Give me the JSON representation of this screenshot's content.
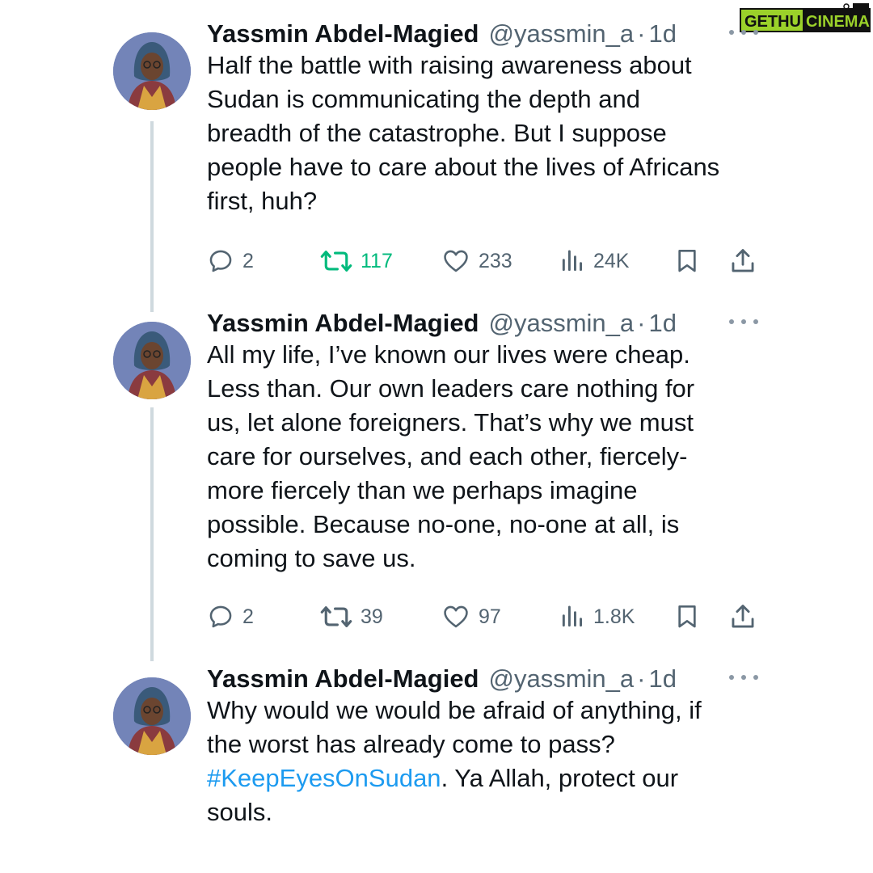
{
  "watermark": {
    "brand_left": "GETHU",
    "brand_right": "CINEMA"
  },
  "colors": {
    "name": "#0f1419",
    "muted": "#536471",
    "retweeted": "#00ba7c",
    "hashtag": "#1d9bf0",
    "thread_line": "#cfd9de"
  },
  "tweets": [
    {
      "author": {
        "name": "Yassmin Abdel-Magied",
        "handle": "@yassmin_a",
        "dot": "·",
        "time": "1d"
      },
      "lines": [
        "Half the battle with raising awareness about",
        "Sudan is communicating the depth and",
        "breadth of the catastrophe. But I suppose",
        "people have to care about the lives of Africans",
        "first, huh?"
      ],
      "stats": {
        "replies": "2",
        "retweets": "117",
        "likes": "233",
        "views": "24K"
      },
      "retweeted": true
    },
    {
      "author": {
        "name": "Yassmin Abdel-Magied",
        "handle": "@yassmin_a",
        "dot": "·",
        "time": "1d"
      },
      "lines": [
        "All my life, I’ve known our lives were cheap.",
        "Less than. Our own leaders care nothing for",
        "us, let alone foreigners. That’s why we must",
        "care for ourselves, and each other, fiercely-",
        "more fiercely than we perhaps imagine",
        "possible. Because no-one, no-one at all, is",
        "coming to save us."
      ],
      "stats": {
        "replies": "2",
        "retweets": "39",
        "likes": "97",
        "views": "1.8K"
      },
      "retweeted": false
    },
    {
      "author": {
        "name": "Yassmin Abdel-Magied",
        "handle": "@yassmin_a",
        "dot": "·",
        "time": "1d"
      },
      "lines": [
        "Why would we would be afraid of anything, if",
        "the worst has already come to pass?"
      ],
      "hashtag": "#KeepEyesOnSudan",
      "hashtag_suffix": ". Ya Allah, protect our",
      "last_line": "souls."
    }
  ]
}
